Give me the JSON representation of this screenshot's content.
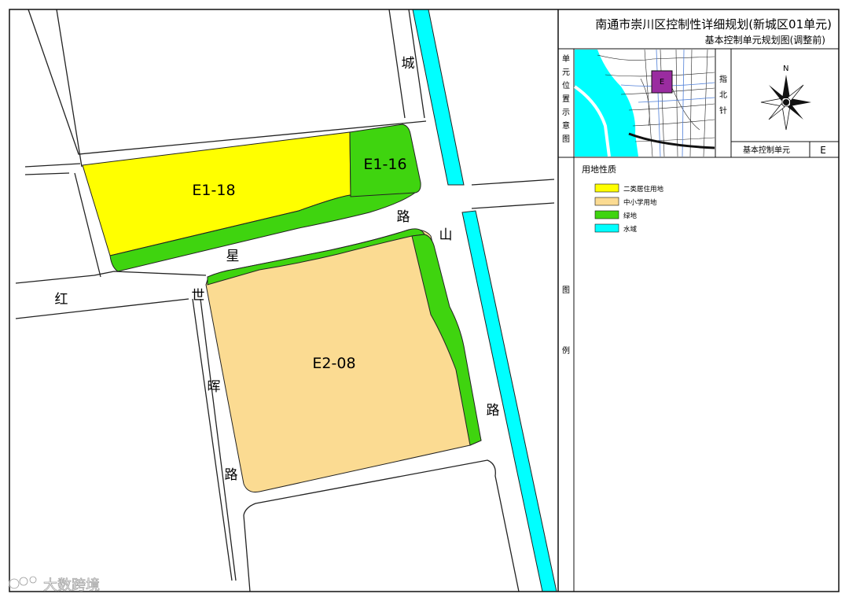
{
  "title": {
    "main": "南通市崇川区控制性详细规划(新城区01单元)",
    "sub": "基本控制单元规划图(调整前)"
  },
  "location_panel": {
    "label_chars": [
      "单",
      "元",
      "位",
      "置",
      "示",
      "意",
      "图"
    ],
    "unit_marker": "E"
  },
  "compass": {
    "label_chars": [
      "指",
      "北",
      "针"
    ],
    "north": "N"
  },
  "unit_row": {
    "label": "基本控制单元",
    "value": "E"
  },
  "legend": {
    "title": "用地性质",
    "side_chars": [
      "图",
      "例"
    ],
    "items": [
      {
        "label": "二类居住用地",
        "color": "#ffff00"
      },
      {
        "label": "中小学用地",
        "color": "#fbdb92"
      },
      {
        "label": "绿地",
        "color": "#3fd40f"
      },
      {
        "label": "水域",
        "color": "#00ffff"
      }
    ]
  },
  "parcels": [
    {
      "id": "E1-18",
      "use": "二类居住用地"
    },
    {
      "id": "E1-16",
      "use": "绿地"
    },
    {
      "id": "E2-08",
      "use": "中小学用地"
    }
  ],
  "roads": {
    "hongxing": [
      "红",
      "星",
      "路"
    ],
    "chengshan": [
      "城",
      "山",
      "路"
    ],
    "shihui": [
      "世",
      "晖",
      "路"
    ]
  },
  "watermark": "大数跨境",
  "colors": {
    "residential": "#ffff00",
    "school": "#fbdb92",
    "green": "#3fd40f",
    "water": "#00ffff",
    "unit_highlight": "#9a2ca0"
  }
}
